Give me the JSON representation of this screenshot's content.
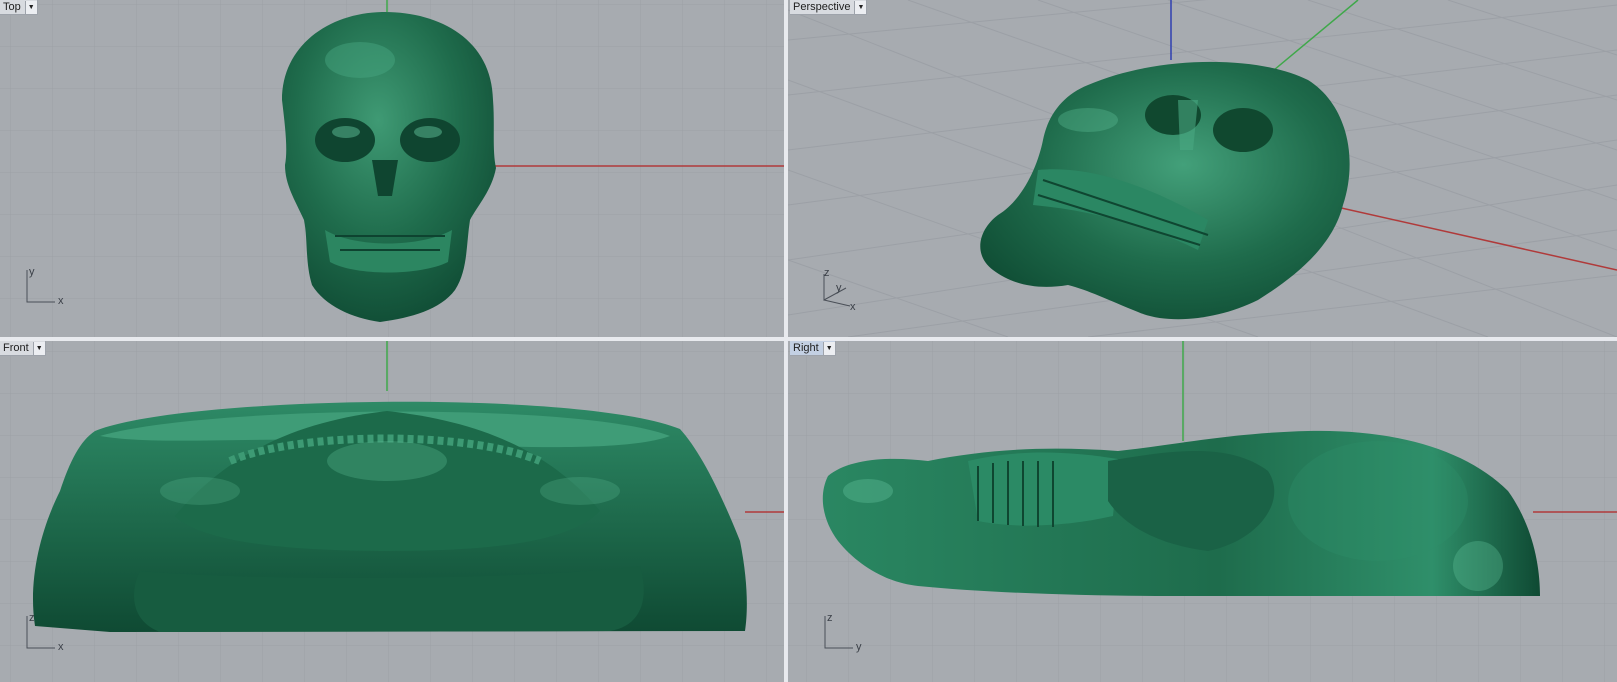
{
  "viewports": [
    {
      "id": "top",
      "label": "Top",
      "active": false,
      "axes": [
        "y",
        "x"
      ]
    },
    {
      "id": "perspective",
      "label": "Perspective",
      "active": false,
      "axes": [
        "z",
        "y",
        "x"
      ]
    },
    {
      "id": "front",
      "label": "Front",
      "active": false,
      "axes": [
        "z",
        "x"
      ]
    },
    {
      "id": "right",
      "label": "Right",
      "active": true,
      "axes": [
        "z",
        "y"
      ]
    }
  ],
  "icons": {
    "menu_arrow": "▼"
  },
  "colors": {
    "viewport_bg": "#a7abb0",
    "grid_minor": "#9ca0a6",
    "grid_major": "#8c9097",
    "axis_x": "#b03a3a",
    "axis_y": "#3fa84a",
    "axis_z": "#2f3fb0",
    "model": "#1d6a4a",
    "model_highlight": "#5fbf98"
  }
}
